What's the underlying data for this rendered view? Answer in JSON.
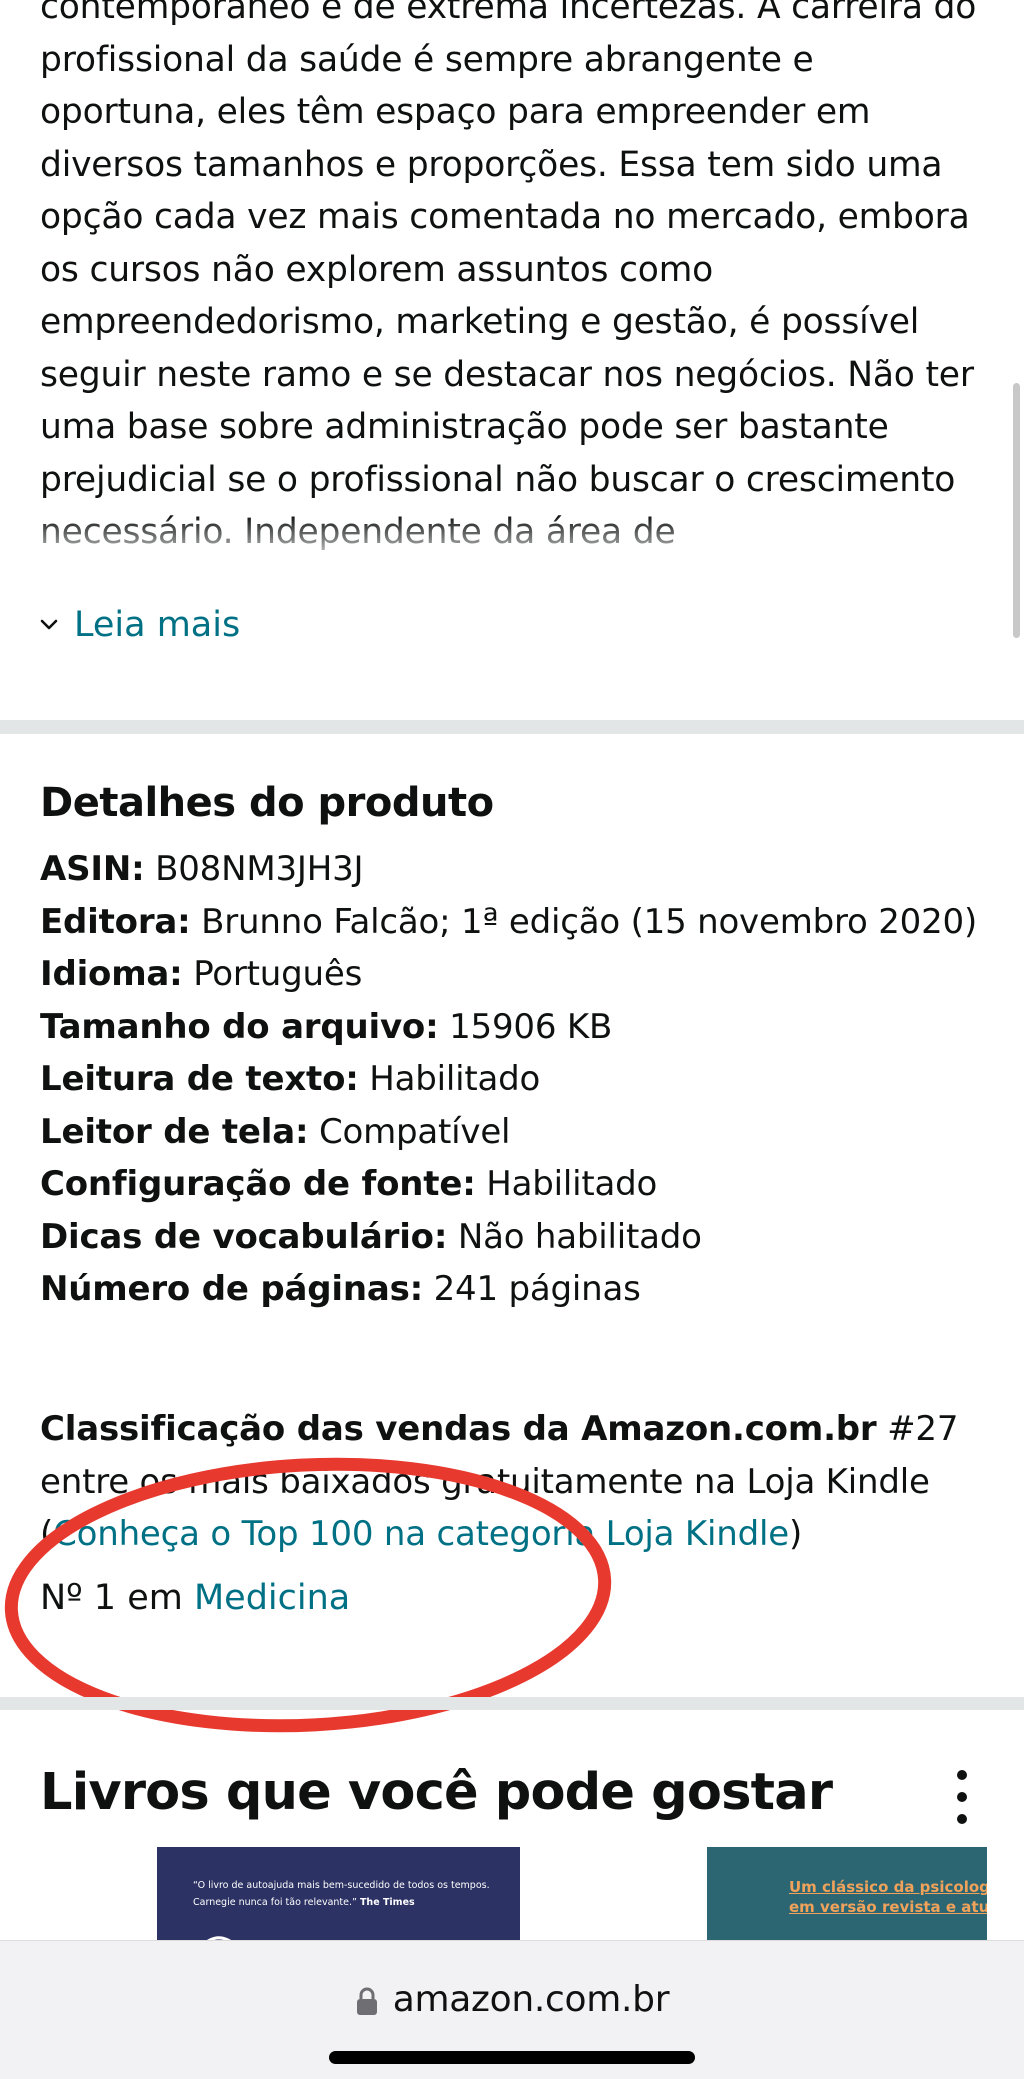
{
  "description": {
    "text": "contemporâneo e de extrema incertezas. A carreira do profissional da saúde é sempre abrangente e oportuna, eles têm espaço para empreender em diversos tamanhos e proporções. Essa tem sido uma opção cada vez mais comentada no mercado, embora os cursos não explorem assuntos como empreendedorismo, marketing e gestão, é possível seguir neste ramo e se destacar nos negócios. Não ter uma base sobre administração pode ser bastante prejudicial se o profissional não buscar o crescimento necessário. Independente da área de",
    "read_more_label": "Leia mais",
    "read_more_icon": "chevron-down-icon"
  },
  "details": {
    "title": "Detalhes do produto",
    "items": [
      {
        "label": "ASIN:",
        "value": "B08NM3JH3J"
      },
      {
        "label": "Editora:",
        "value": "Brunno Falcão; 1ª edição (15 novembro 2020)"
      },
      {
        "label": "Idioma:",
        "value": "Português"
      },
      {
        "label": "Tamanho do arquivo:",
        "value": "15906 KB"
      },
      {
        "label": "Leitura de texto:",
        "value": "Habilitado"
      },
      {
        "label": "Leitor de tela:",
        "value": "Compatível"
      },
      {
        "label": "Configuração de fonte:",
        "value": "Habilitado"
      },
      {
        "label": "Dicas de vocabulário:",
        "value": "Não habilitado"
      },
      {
        "label": "Número de páginas:",
        "value": "241 páginas"
      }
    ]
  },
  "sales_rank": {
    "label": "Classificação das vendas da Amazon.com.br",
    "rank": "#27",
    "rank_text": "entre os mais baixados gratuitamente na Loja Kindle",
    "open_paren": "(",
    "top100_link": "Conheça o Top 100 na categoria Loja Kindle",
    "close_paren": ")",
    "category_prefix": "Nº 1 em",
    "category_link": "Medicina",
    "annotation_color": "#e8392f"
  },
  "recommendations": {
    "title": "Livros que você pode gostar",
    "more_icon": "more-vertical-icon",
    "books": [
      {
        "blurb": "“O livro de autoajuda mais bem-sucedido de todos os tempos. Carnegie nunca foi tão relevante.”",
        "blurb_source": "The Times",
        "cover_color": "#2c3263"
      },
      {
        "tagline_line1": "Um clássico da psicologia",
        "tagline_line2": "em versão revista e atualiza",
        "cover_color": "#2c6673"
      }
    ]
  },
  "browser": {
    "url": "amazon.com.br",
    "lock_icon": "lock-icon"
  },
  "colors": {
    "link": "#007185",
    "text": "#0f1111",
    "divider": "#e3e6e6"
  }
}
